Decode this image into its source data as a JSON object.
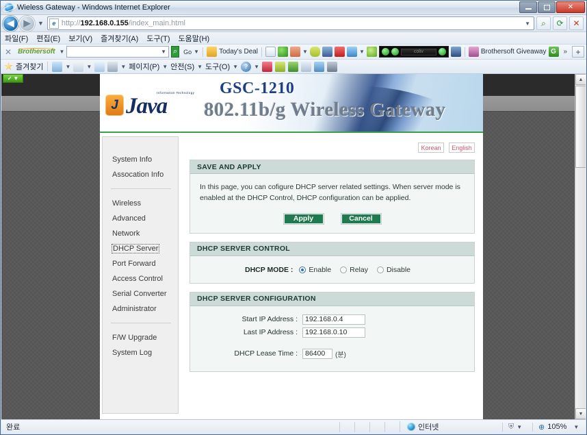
{
  "window": {
    "title": "Wieless Gateway - Windows Internet Explorer",
    "minimize_label": "Minimize",
    "maximize_label": "Maximize",
    "close_label": "✕"
  },
  "address_bar": {
    "back_label": "◀",
    "forward_label": "▶",
    "history_caret": "▼",
    "url_prefix": "http://",
    "url_host": "192.168.0.155",
    "url_path": "/index_main.html",
    "url_dropdown": "▼",
    "search_button": "⌕",
    "refresh_button": "⟳",
    "stop_button": "✕"
  },
  "menu_bar": {
    "items": [
      "파일(F)",
      "편집(E)",
      "보기(V)",
      "즐겨찾기(A)",
      "도구(T)",
      "도움말(H)"
    ]
  },
  "brothersoft_toolbar": {
    "close_label": "✕",
    "logo_text": "Brothersoft",
    "logo_caret": "▼",
    "search_value": "",
    "search_caret": "▼",
    "go_label": "Go",
    "go_caret": "▼",
    "todays_deal": "Today's Deal",
    "giveaway_label": "Brothersoft Giveaway",
    "google_badge": "G",
    "overflow_label": "»",
    "add_label": "+",
    "black_widget_text": "coliv"
  },
  "command_bar": {
    "favorites_label": "즐겨찾기",
    "page_label": "페이지(P)",
    "safety_label": "안전(S)",
    "tools_label": "도구(O)",
    "help_label": "?",
    "caret": "▼"
  },
  "page": {
    "green_badge": "✓",
    "banner": {
      "model": "GSC-1210",
      "subtitle": "802.11b/g Wireless Gateway",
      "brand": "Java",
      "brand_mark": "J",
      "brand_tagline": "Information Technology"
    },
    "sidebar": {
      "groups": [
        {
          "items": [
            "System Info",
            "Assocation Info"
          ]
        },
        {
          "items": [
            "Wireless",
            "Advanced",
            "Network",
            "DHCP Server",
            "Port Forward",
            "Access Control",
            "Serial Converter",
            "Administrator"
          ]
        },
        {
          "items": [
            "F/W Upgrade",
            "System Log"
          ]
        }
      ],
      "selected": "DHCP Server"
    },
    "language": {
      "korean": "Korean",
      "english": "English"
    },
    "save_and_apply": {
      "title": "SAVE AND APPLY",
      "description": "In this page, you can cofigure DHCP server related settings. When server mode is enabled at the DHCP Control, DHCP configuration can be applied.",
      "apply_label": "Apply",
      "cancel_label": "Cancel"
    },
    "dhcp_server_control": {
      "title": "DHCP SERVER CONTROL",
      "mode_label": "DHCP MODE :",
      "options": [
        {
          "label": "Enable",
          "selected": true
        },
        {
          "label": "Relay",
          "selected": false
        },
        {
          "label": "Disable",
          "selected": false
        }
      ]
    },
    "dhcp_server_configuration": {
      "title": "DHCP SERVER CONFIGURATION",
      "start_ip_label": "Start IP Address :",
      "start_ip_value": "192.168.0.4",
      "last_ip_label": "Last IP Address :",
      "last_ip_value": "192.168.0.10",
      "lease_time_label": "DHCP Lease Time :",
      "lease_time_value": "86400",
      "lease_time_unit": "(분)"
    },
    "scrollbar": {
      "up": "▲",
      "down": "▼"
    }
  },
  "status_bar": {
    "state": "완료",
    "zone": "인터넷",
    "protected_mode_caret": "▼",
    "zoom_level": "105%",
    "zoom_caret": "▼"
  },
  "colors": {
    "banner_model": "#1d3f86",
    "panel_head_bg": "#ccdbd7",
    "button_green": "#1f7a4f",
    "lang_text": "#d0576b",
    "accent_green_rule": "#3aa04b"
  }
}
